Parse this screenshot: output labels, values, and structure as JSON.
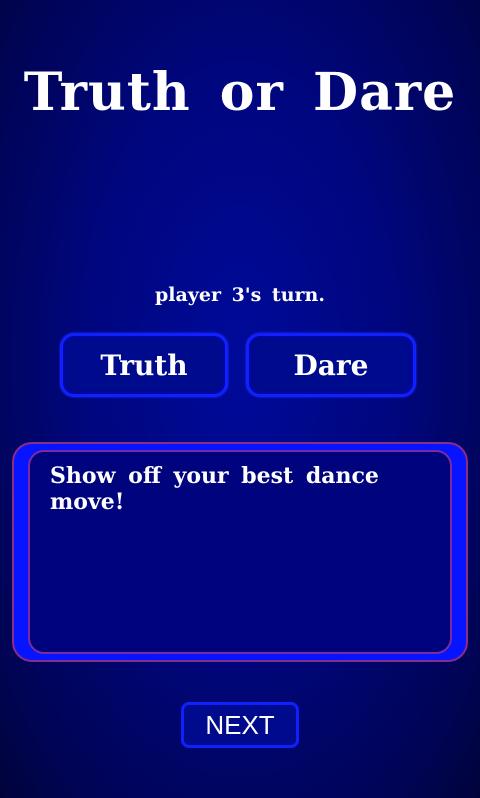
{
  "app": {
    "title": "Truth or Dare"
  },
  "status": {
    "turn_text": "player 3's turn."
  },
  "choices": {
    "truth_label": "Truth",
    "dare_label": "Dare"
  },
  "card": {
    "text": "Show off your best dance move!"
  },
  "footer": {
    "next_label": "NEXT"
  },
  "colors": {
    "background": "#000a8a",
    "button_border": "#1020ff",
    "card_outer": "#0614ff",
    "card_inner": "#00037e",
    "card_border": "#8a2c8a",
    "text": "#ffffff"
  }
}
